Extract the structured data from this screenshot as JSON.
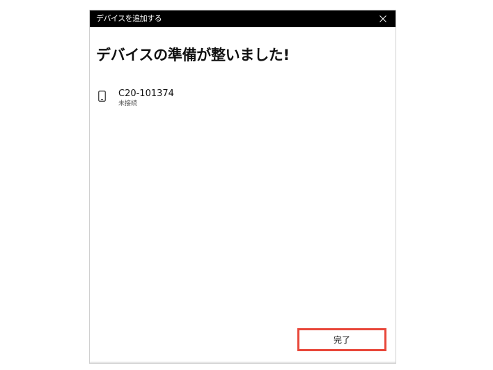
{
  "window": {
    "title": "デバイスを追加する",
    "close_icon": "close-icon"
  },
  "main": {
    "heading": "デバイスの準備が整いました!"
  },
  "device": {
    "icon": "phone-icon",
    "name": "C20-101374",
    "status": "未接続"
  },
  "footer": {
    "finish_label": "完了",
    "highlight_color": "#e8473a"
  }
}
